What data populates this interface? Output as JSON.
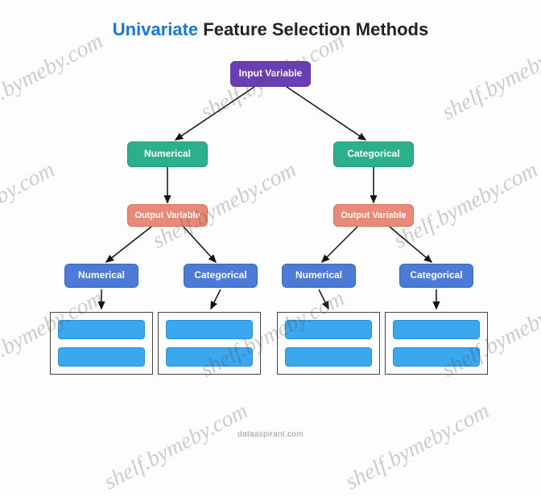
{
  "title": {
    "accent": "Univariate",
    "rest": " Feature Selection Methods"
  },
  "root": {
    "label": "Input Variable"
  },
  "level2": {
    "left": {
      "label": "Numerical"
    },
    "right": {
      "label": "Categorical"
    }
  },
  "level3": {
    "left": {
      "label": "Output Variable"
    },
    "right": {
      "label": "Output Variable"
    }
  },
  "level4": {
    "a": {
      "label": "Numerical"
    },
    "b": {
      "label": "Categorical"
    },
    "c": {
      "label": "Numerical"
    },
    "d": {
      "label": "Categorical"
    }
  },
  "methods": {
    "a": [
      " ",
      " "
    ],
    "b": [
      " ",
      " "
    ],
    "c": [
      " ",
      " "
    ],
    "d": [
      " ",
      " "
    ]
  },
  "source": "dataaspirant.com",
  "watermark": "shelf.bymeby.com",
  "colors": {
    "accent": "#1877d6",
    "root": "#6a3fb5",
    "l2": "#2bb08b",
    "l3": "#e88a77",
    "l4": "#4b7bd6",
    "method": "#3aa7ef"
  }
}
